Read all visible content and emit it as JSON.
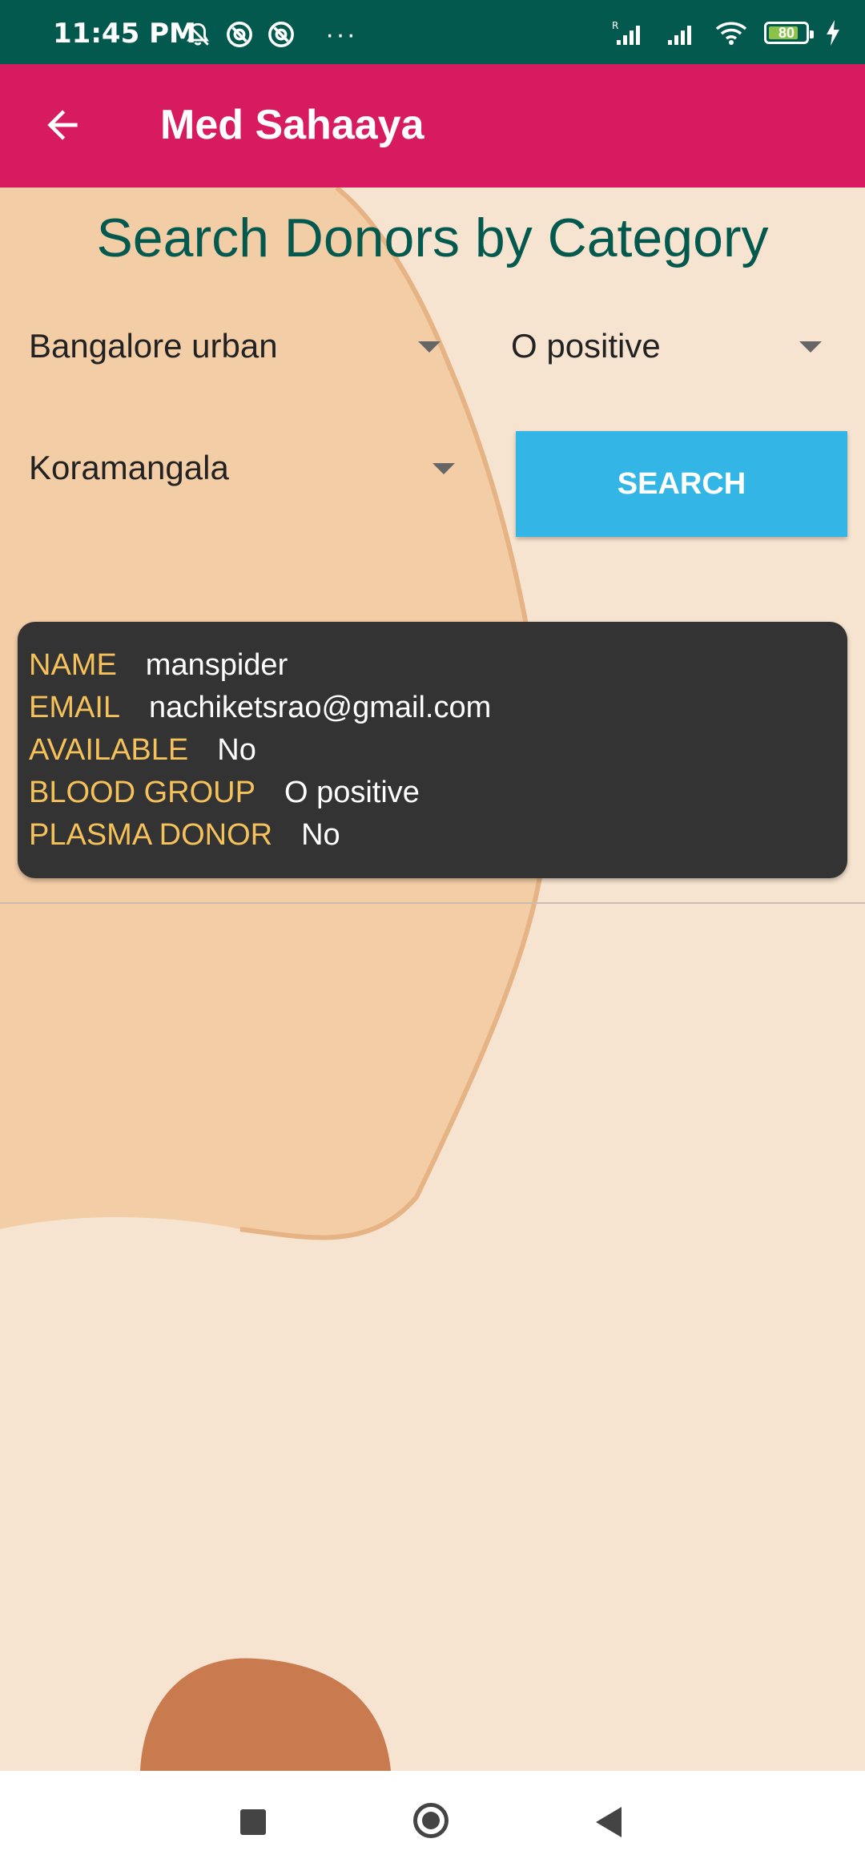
{
  "status_bar": {
    "time": "11:45 PM",
    "more": "···",
    "battery": "80",
    "icons": [
      "muted-bell-icon",
      "sync-icon",
      "sync-icon",
      "signal-r-icon",
      "signal-icon",
      "wifi-icon",
      "battery-icon",
      "charging-icon"
    ]
  },
  "app_bar": {
    "title": "Med Sahaaya",
    "back_icon": "arrow-left-icon"
  },
  "page": {
    "heading": "Search Donors by Category"
  },
  "filters": {
    "district": "Bangalore urban",
    "blood_group": "O positive",
    "area": "Koramangala",
    "search_label": "SEARCH"
  },
  "donor": {
    "name_label": "NAME",
    "name": "manspider",
    "email_label": "EMAIL",
    "email": "nachiketsrao@gmail.com",
    "available_label": "AVAILABLE",
    "available": "No",
    "blood_group_label": "BLOOD GROUP",
    "blood_group": "O positive",
    "plasma_label": "PLASMA DONOR",
    "plasma": "No"
  },
  "colors": {
    "status_bar": "#03594e",
    "app_bar": "#d81b60",
    "heading": "#03594e",
    "button": "#33b5e5",
    "card": "#333333",
    "card_label": "#f5c15a"
  },
  "nav_bar": {
    "icons": [
      "recent-apps-icon",
      "home-icon",
      "back-icon"
    ]
  }
}
